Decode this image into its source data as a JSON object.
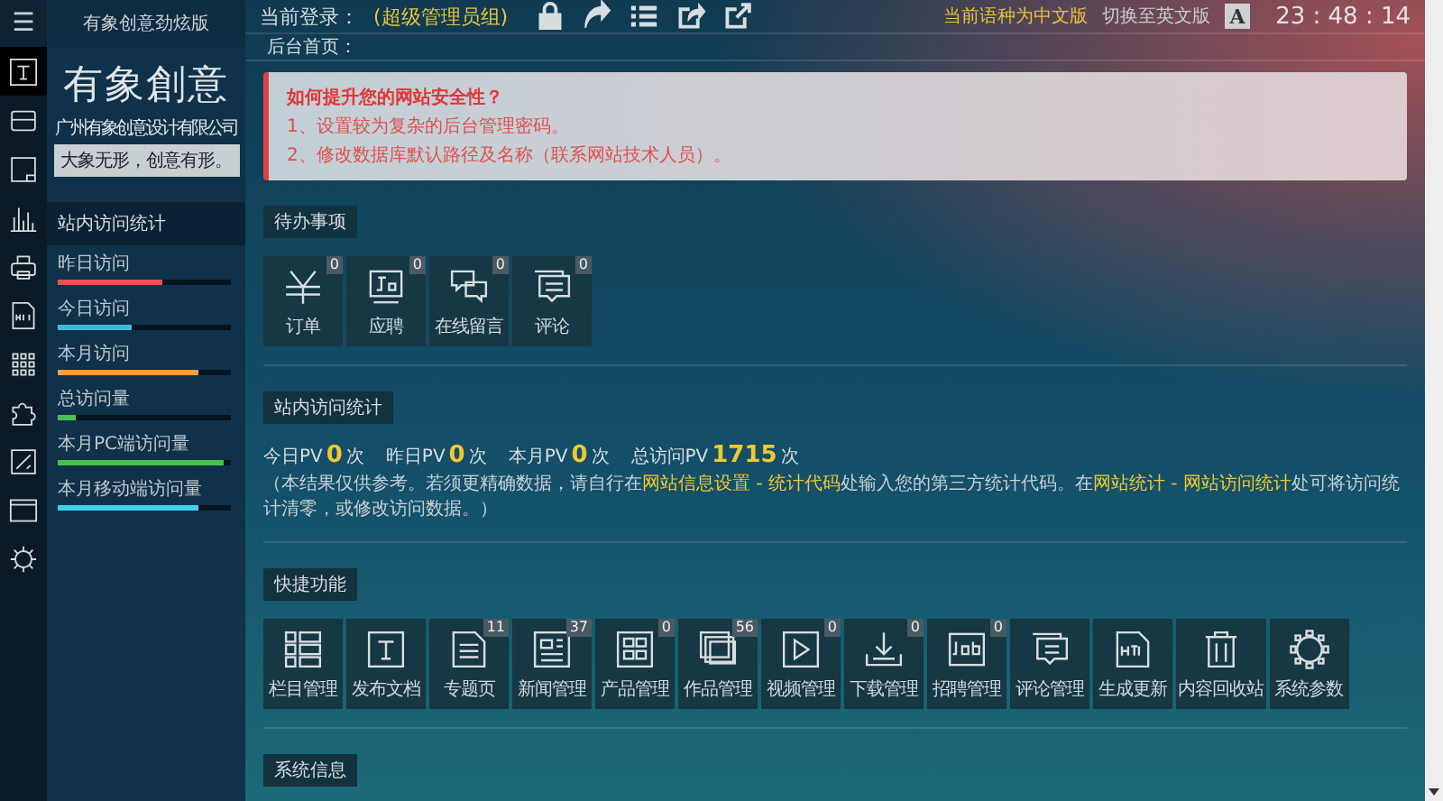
{
  "menu_button": "☰",
  "app_title": "有象创意劲炫版",
  "header": {
    "login_label": "当前登录：",
    "role": "(超级管理员组)",
    "language_current": "当前语种为中文版",
    "language_switch": "切换至英文版",
    "font_button": "A",
    "clock": "23 : 48 : 14"
  },
  "rail_items": [
    {
      "selected": true
    },
    {
      "selected": false
    },
    {
      "selected": false
    },
    {
      "selected": false
    },
    {
      "selected": false
    },
    {
      "selected": false
    },
    {
      "selected": false
    },
    {
      "selected": false
    },
    {
      "selected": false
    },
    {
      "selected": false
    },
    {
      "selected": false
    }
  ],
  "logo": {
    "title": "有象創意",
    "company": "广州有象创意设计有限公司",
    "slogan": "大象无形，创意有形。"
  },
  "sidebar_stats": {
    "title": "站内访问统计",
    "items": [
      {
        "label": "昨日访问",
        "level": 0.6,
        "color": "#e05555"
      },
      {
        "label": "今日访问",
        "level": 0.43,
        "color": "#3fb8dc"
      },
      {
        "label": "本月访问",
        "level": 0.81,
        "color": "#f0a040"
      },
      {
        "label": "总访问量",
        "level": 0.1,
        "color": "#4cc04c"
      },
      {
        "label": "本月PC端访问量",
        "level": 0.96,
        "color": "#4cc04c"
      },
      {
        "label": "本月移动端访问量",
        "level": 0.81,
        "color": "#3fd0f0"
      }
    ]
  },
  "breadcrumb": "后台首页：",
  "alert": {
    "title": "如何提升您的网站安全性？",
    "lines": [
      "1、设置较为复杂的后台管理密码。",
      "2、修改数据库默认路径及名称（联系网站技术人员）。"
    ]
  },
  "todo": {
    "title": "待办事项",
    "tiles": [
      {
        "label": "订单",
        "badge": "0"
      },
      {
        "label": "应聘",
        "badge": "0"
      },
      {
        "label": "在线留言",
        "badge": "0"
      },
      {
        "label": "评论",
        "badge": "0"
      }
    ]
  },
  "visits": {
    "title": "站内访问统计",
    "counters": [
      {
        "label": "今日PV",
        "value": "0",
        "unit": "次"
      },
      {
        "label": "昨日PV",
        "value": "0",
        "unit": "次"
      },
      {
        "label": "本月PV",
        "value": "0",
        "unit": "次"
      },
      {
        "label": "总访问PV",
        "value": "1715",
        "unit": "次"
      }
    ],
    "note": [
      {
        "text": "（本结果仅供参考。若须更精确数据，请自行在",
        "link": false
      },
      {
        "text": "网站信息设置 - 统计代码",
        "link": true
      },
      {
        "text": "处输入您的第三方统计代码。在",
        "link": false
      },
      {
        "text": "网站统计 - 网站访问统计",
        "link": true
      },
      {
        "text": "处可将访问统计清零，或修改访问数据。）",
        "link": false
      }
    ]
  },
  "quick": {
    "title": "快捷功能",
    "tiles": [
      {
        "label": "栏目管理"
      },
      {
        "label": "发布文档"
      },
      {
        "label": "专题页",
        "badge": "11"
      },
      {
        "label": "新闻管理",
        "badge": "37"
      },
      {
        "label": "产品管理",
        "badge": "0"
      },
      {
        "label": "作品管理",
        "badge": "56"
      },
      {
        "label": "视频管理",
        "badge": "0"
      },
      {
        "label": "下载管理",
        "badge": "0"
      },
      {
        "label": "招聘管理",
        "badge": "0"
      },
      {
        "label": "评论管理"
      },
      {
        "label": "生成更新"
      },
      {
        "label": "内容回收站"
      },
      {
        "label": "系统参数"
      }
    ]
  },
  "system": {
    "title": "系统信息"
  }
}
